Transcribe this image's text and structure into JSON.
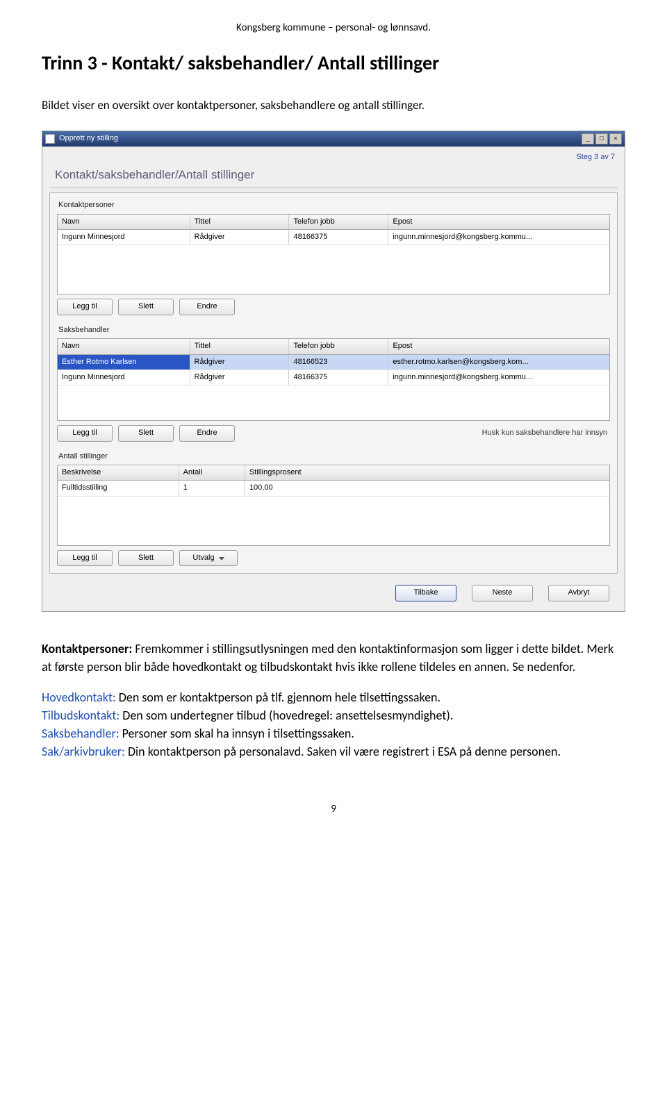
{
  "doc": {
    "header": "Kongsberg kommune – personal- og lønnsavd.",
    "title": "Trinn 3 - Kontakt/ saksbehandler/ Antall stillinger",
    "intro": "Bildet viser en oversikt over kontaktpersoner, saksbehandlere og antall stillinger.",
    "page_number": "9"
  },
  "app": {
    "window_title": "Opprett ny stilling",
    "step_indicator": "Steg 3 av 7",
    "wizard_title": "Kontakt/saksbehandler/Antall stillinger",
    "sections": {
      "kontaktpersoner": {
        "label": "Kontaktpersoner",
        "headers": [
          "Navn",
          "Tittel",
          "Telefon jobb",
          "Epost"
        ],
        "rows": [
          {
            "navn": "Ingunn Minnesjord",
            "tittel": "Rådgiver",
            "tlf": "48166375",
            "epost": "ingunn.minnesjord@kongsberg.kommu..."
          }
        ],
        "buttons": {
          "add": "Legg til",
          "del": "Slett",
          "edit": "Endre"
        }
      },
      "saksbehandler": {
        "label": "Saksbehandler",
        "headers": [
          "Navn",
          "Tittel",
          "Telefon jobb",
          "Epost"
        ],
        "rows": [
          {
            "navn": "Esther Rotmo Karlsen",
            "tittel": "Rådgiver",
            "tlf": "48166523",
            "epost": "esther.rotmo.karlsen@kongsberg.kom..."
          },
          {
            "navn": "Ingunn Minnesjord",
            "tittel": "Rådgiver",
            "tlf": "48166375",
            "epost": "ingunn.minnesjord@kongsberg.kommu..."
          }
        ],
        "buttons": {
          "add": "Legg til",
          "del": "Slett",
          "edit": "Endre"
        },
        "hint": "Husk kun saksbehandlere har innsyn"
      },
      "antall": {
        "label": "Antall stillinger",
        "headers": [
          "Beskrivelse",
          "Antall",
          "Stillingsprosent"
        ],
        "rows": [
          {
            "besk": "Fulltidsstilling",
            "ant": "1",
            "pros": "100,00"
          }
        ],
        "buttons": {
          "add": "Legg til",
          "del": "Slett",
          "utvalg": "Utvalg"
        }
      }
    },
    "wizard_buttons": {
      "back": "Tilbake",
      "next": "Neste",
      "cancel": "Avbryt"
    }
  },
  "body_text": {
    "p1_label": "Kontaktpersoner:",
    "p1_rest": " Fremkommer i stillingsutlysningen med den kontaktinformasjon som ligger i dette bildet. Merk at første person blir både hovedkontakt og tilbudskontakt hvis ikke rollene tildeles en annen. Se nedenfor.",
    "hoved_label": "Hovedkontakt:",
    "hoved_rest": " Den som er kontaktperson på tlf. gjennom hele tilsettingssaken.",
    "tilbud_label": "Tilbudskontakt:",
    "tilbud_rest": " Den som undertegner tilbud (hovedregel: ansettelsesmyndighet).",
    "saks_label": "Saksbehandler:",
    "saks_rest": " Personer som skal ha innsyn i tilsettingssaken.",
    "sak_label": "Sak/arkivbruker:",
    "sak_rest": " Din kontaktperson på personalavd. Saken vil være registrert i ESA på denne personen."
  }
}
